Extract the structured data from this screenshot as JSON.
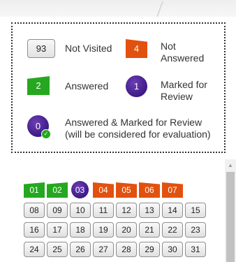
{
  "legend": {
    "not_visited": {
      "count": "93",
      "label": "Not Visited"
    },
    "not_answered": {
      "count": "4",
      "label_line1": "Not",
      "label_line2": "Answered"
    },
    "answered": {
      "count": "2",
      "label": "Answered"
    },
    "marked": {
      "count": "1",
      "label_line1": "Marked for",
      "label_line2": "Review"
    },
    "answered_marked": {
      "count": "0",
      "label_line1": "Answered & Marked for Review",
      "label_line2": "(will be considered for evaluation)"
    }
  },
  "palette": {
    "rows": [
      [
        {
          "n": "01",
          "s": "answered"
        },
        {
          "n": "02",
          "s": "answered"
        },
        {
          "n": "03",
          "s": "marked"
        },
        {
          "n": "04",
          "s": "not_answered"
        },
        {
          "n": "05",
          "s": "not_answered"
        },
        {
          "n": "06",
          "s": "not_answered"
        },
        {
          "n": "07",
          "s": "not_answered"
        }
      ],
      [
        {
          "n": "08",
          "s": "not_visited"
        },
        {
          "n": "09",
          "s": "not_visited"
        },
        {
          "n": "10",
          "s": "not_visited"
        },
        {
          "n": "11",
          "s": "not_visited"
        },
        {
          "n": "12",
          "s": "not_visited"
        },
        {
          "n": "13",
          "s": "not_visited"
        },
        {
          "n": "14",
          "s": "not_visited"
        },
        {
          "n": "15",
          "s": "not_visited"
        }
      ],
      [
        {
          "n": "16",
          "s": "not_visited"
        },
        {
          "n": "17",
          "s": "not_visited"
        },
        {
          "n": "18",
          "s": "not_visited"
        },
        {
          "n": "19",
          "s": "not_visited"
        },
        {
          "n": "20",
          "s": "not_visited"
        },
        {
          "n": "21",
          "s": "not_visited"
        },
        {
          "n": "22",
          "s": "not_visited"
        },
        {
          "n": "23",
          "s": "not_visited"
        }
      ],
      [
        {
          "n": "24",
          "s": "not_visited"
        },
        {
          "n": "25",
          "s": "not_visited"
        },
        {
          "n": "26",
          "s": "not_visited"
        },
        {
          "n": "27",
          "s": "not_visited"
        },
        {
          "n": "28",
          "s": "not_visited"
        },
        {
          "n": "29",
          "s": "not_visited"
        },
        {
          "n": "30",
          "s": "not_visited"
        },
        {
          "n": "31",
          "s": "not_visited"
        }
      ]
    ]
  },
  "colors": {
    "answered": "#25a81f",
    "not_answered": "#e2510f",
    "marked": "#4b2596",
    "not_visited": "#e8e8e8"
  },
  "icons": {
    "scroll_up": "triangle-up-icon",
    "answered_marked_badge": "check-badge-icon"
  }
}
